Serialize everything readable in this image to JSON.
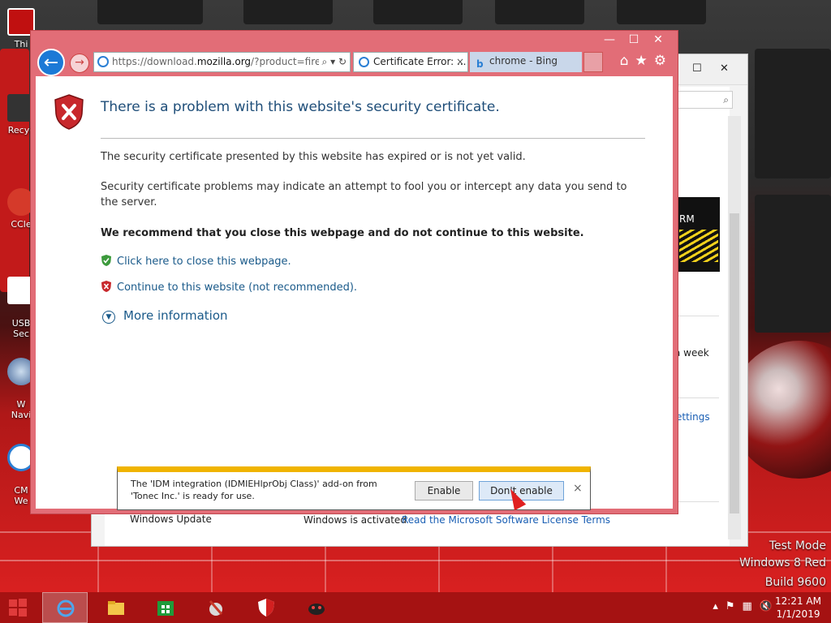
{
  "desktop": {
    "icons": [
      {
        "label": "Thi"
      },
      {
        "label": "Recyc"
      },
      {
        "label": "CCle"
      },
      {
        "label": "USB\nSec"
      },
      {
        "label": "W\nNavi"
      },
      {
        "label": "CM\nWe"
      }
    ],
    "watermark": {
      "line1": "Test Mode",
      "line2": "Windows 8 Red",
      "line3": "Build 9600"
    }
  },
  "background_window": {
    "partial_text": {
      "week": "a week",
      "settings": "ettings",
      "windows_update": "Windows Update",
      "activated": "Windows is activated",
      "license_link": "Read the Microsoft Software License Terms",
      "logo_text": "RM"
    },
    "controls": {
      "minimize": "—",
      "restore": "☐",
      "close": "✕"
    }
  },
  "ie": {
    "window_controls": {
      "minimize": "—",
      "restore": "☐",
      "close": "✕"
    },
    "address_prefix": "https://download.",
    "address_domain": "mozilla.org",
    "address_suffix": "/?product=firef",
    "tabs": [
      {
        "label": "Certificate Error: ...",
        "close": "×"
      },
      {
        "label": "chrome - Bing"
      }
    ],
    "page": {
      "title": "There is a problem with this website's security certificate.",
      "para1": "The security certificate presented by this website has expired or is not yet valid.",
      "para2": "Security certificate problems may indicate an attempt to fool you or intercept any data you send to the server.",
      "recommend": "We recommend that you close this webpage and do not continue to this website.",
      "close_link": "Click here to close this webpage.",
      "continue_link": "Continue to this website (not recommended).",
      "more_info": "More information"
    }
  },
  "notification": {
    "message": "The 'IDM integration (IDMIEHlprObj Class)' add-on from 'Tonec Inc.' is ready for use.",
    "enable_label": "Enable",
    "dont_enable_label": "Don't enable",
    "close": "×"
  },
  "taskbar": {
    "time": "12:21 AM",
    "date": "1/1/2019"
  },
  "colors": {
    "accent": "#1c79d6",
    "window_frame": "#e26d77",
    "taskbar": "#a51212",
    "notif_bar": "#f0b400"
  }
}
